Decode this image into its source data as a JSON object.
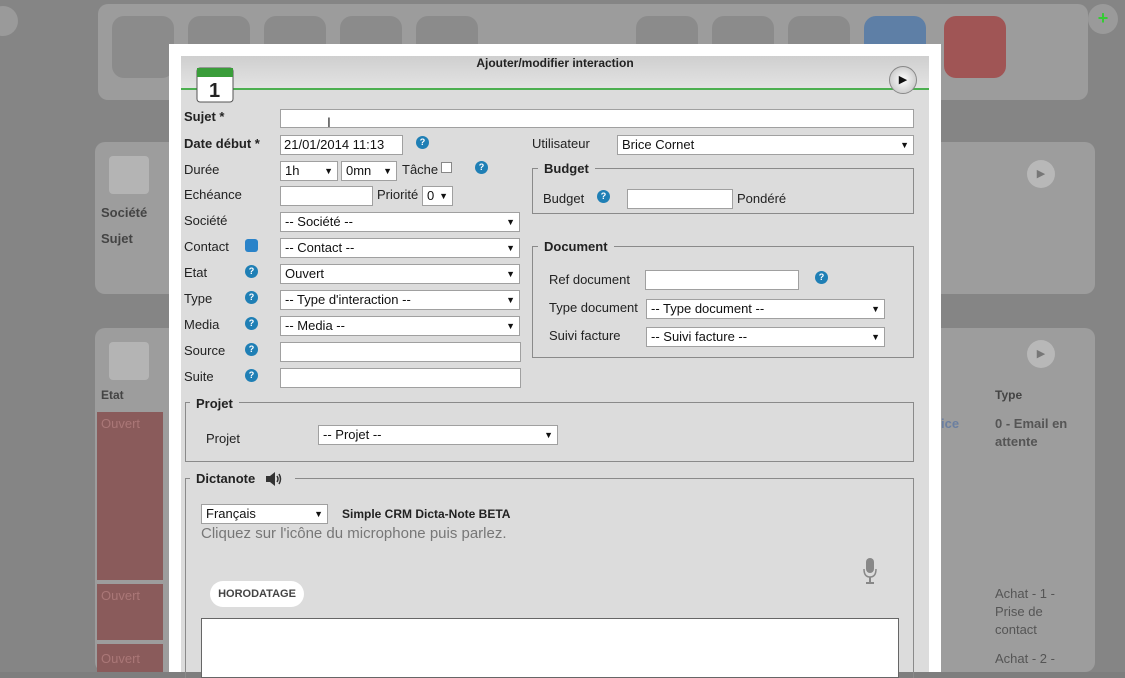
{
  "dialog": {
    "title": "Ajouter/modifier interaction"
  },
  "fields": {
    "sujet_label": "Sujet *",
    "sujet_value": "",
    "date_debut_label": "Date début *",
    "date_debut_value": "21/01/2014 11:13",
    "duree_label": "Durée",
    "duree_hours": "1h",
    "duree_minutes": "0mn",
    "tache_label": "Tâche",
    "echeance_label": "Echéance",
    "echeance_value": "",
    "priorite_label": "Priorité",
    "priorite_value": "0",
    "societe_label": "Société",
    "societe_value": "-- Société --",
    "contact_label": "Contact",
    "contact_value": "-- Contact --",
    "etat_label": "Etat",
    "etat_value": "Ouvert",
    "type_label": "Type",
    "type_value": "-- Type d'interaction --",
    "media_label": "Media",
    "media_value": "-- Media --",
    "source_label": "Source",
    "source_value": "",
    "suite_label": "Suite",
    "suite_value": "",
    "utilisateur_label": "Utilisateur",
    "utilisateur_value": "Brice Cornet"
  },
  "budget": {
    "legend": "Budget",
    "label": "Budget",
    "value": "",
    "pondere_label": "Pondéré"
  },
  "document": {
    "legend": "Document",
    "ref_label": "Ref document",
    "ref_value": "",
    "type_label": "Type document",
    "type_value": "-- Type document --",
    "suivi_label": "Suivi facture",
    "suivi_value": "-- Suivi facture --"
  },
  "projet": {
    "legend": "Projet",
    "label": "Projet",
    "value": "-- Projet --"
  },
  "dictanote": {
    "legend": "Dictanote",
    "language": "Français",
    "product": "Simple CRM Dicta-Note BETA",
    "instruction": "Cliquez sur l'icône du microphone puis parlez.",
    "timestamp_button": "HORODATAGE",
    "text": ""
  },
  "background": {
    "societe": "Société",
    "sujet": "Sujet",
    "col_etat": "Etat",
    "col_type": "Type",
    "ice": "ice",
    "rows": [
      {
        "etat": "Ouvert",
        "type": "0 - Email en attente"
      },
      {
        "etat": "Ouvert",
        "type": "Achat - 1 - Prise de contact"
      },
      {
        "etat": "Ouvert",
        "type": "Achat - 2 -"
      }
    ]
  },
  "colors": {
    "accent_green": "#4caf50",
    "help_blue": "#1f7fb5"
  }
}
